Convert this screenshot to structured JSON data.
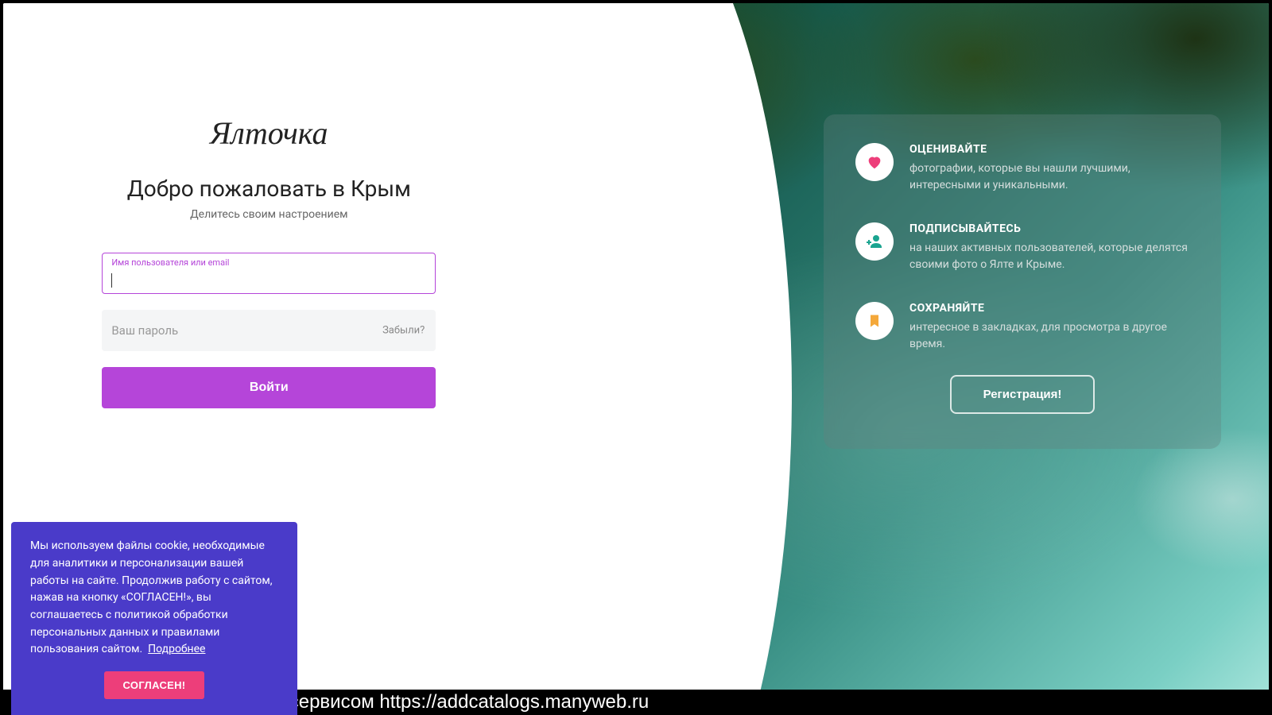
{
  "left": {
    "logo": "Ялточка",
    "title": "Добро пожаловать в Крым",
    "subtitle": "Делитесь своим настроением",
    "username_label": "Имя пользователя или email",
    "username_value": "",
    "password_placeholder": "Ваш пароль",
    "password_value": "",
    "forgot_label": "Забыли?",
    "login_label": "Войти"
  },
  "features": {
    "items": [
      {
        "icon": "heart-icon",
        "title": "ОЦЕНИВАЙТЕ",
        "desc": "фотографии, которые вы нашли лучшими, интересными и уникальными."
      },
      {
        "icon": "person-add-icon",
        "title": "ПОДПИСЫВАЙТЕСЬ",
        "desc": "на наших активных пользователей, которые делятся своими фото о Ялте и Крыме."
      },
      {
        "icon": "bookmark-icon",
        "title": "СОХРАНЯЙТЕ",
        "desc": "интересное в закладках, для просмотра в другое время."
      }
    ],
    "register_label": "Регистрация!"
  },
  "cookie": {
    "text": "Мы используем файлы cookie, необходимые для аналитики и персонализации вашей работы на сайте. Продолжив работу с сайтом, нажав на кнопку «СОГЛАСЕН!», вы соглашаетесь с политикой обработки персональных данных и правилами пользования сайтом.",
    "more_label": "Подробнее",
    "accept_label": "СОГЛАСЕН!"
  },
  "footer": {
    "text": "Снимок \"ялточка.рф\" сделан сервисом https://addcatalogs.manyweb.ru"
  }
}
